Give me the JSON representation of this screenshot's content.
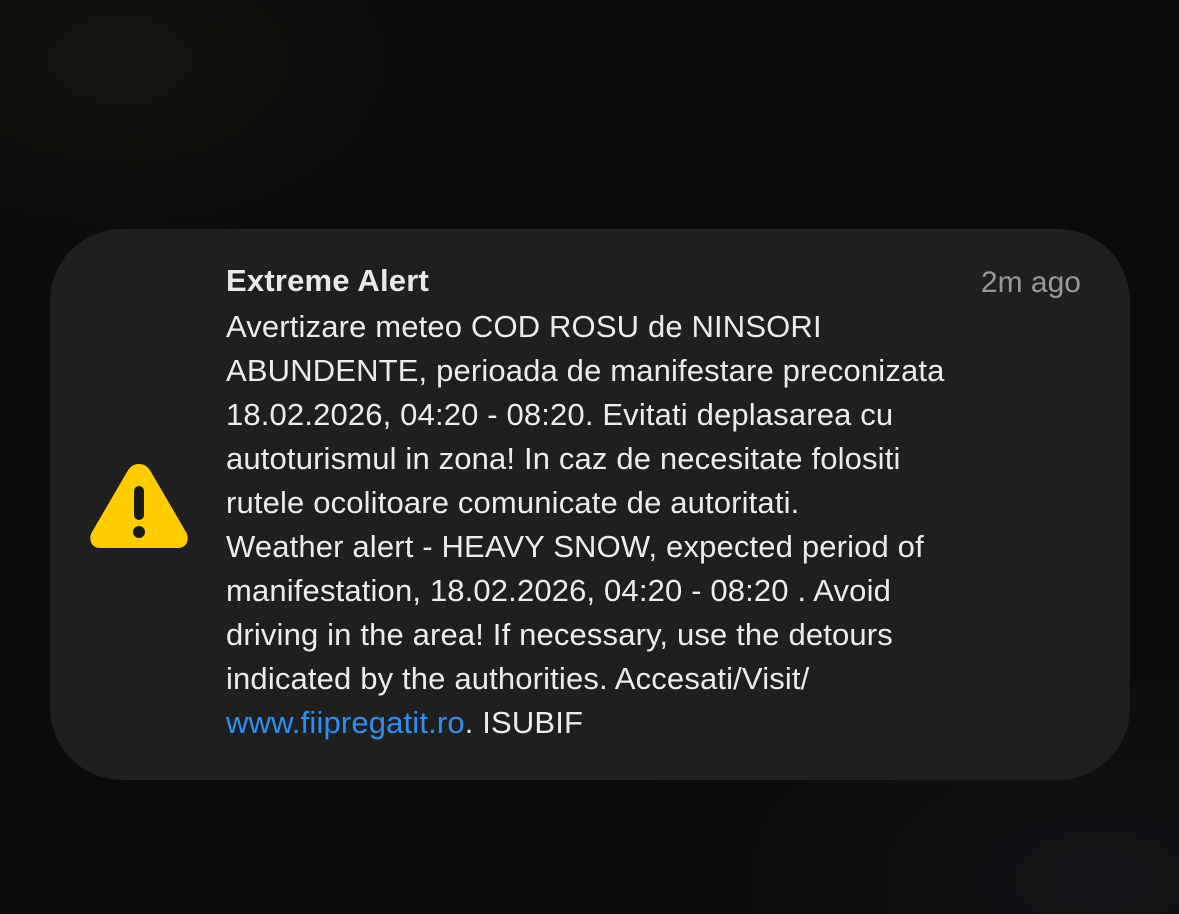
{
  "notification": {
    "title": "Extreme Alert",
    "timestamp": "2m ago",
    "icon": "warning-triangle-icon",
    "icon_color": "#FFCC00",
    "body_lines": [
      "Avertizare meteo COD ROSU de NINSORI",
      "ABUNDENTE, perioada de manifestare preconizata",
      "18.02.2026, 04:20 - 08:20. Evitati deplasarea cu",
      "autoturismul in zona! In caz de necesitate folositi",
      "rutele ocolitoare comunicate de autoritati.",
      "Weather alert - HEAVY SNOW, expected period of",
      "manifestation, 18.02.2026, 04:20 - 08:20 . Avoid",
      "driving in the area! If necessary, use the detours",
      "indicated by the authorities. Accesati/Visit/"
    ],
    "link_text": "www.fiipregatit.ro",
    "link_color": "#2F8FF0",
    "trailing_text": ". ISUBIF"
  }
}
